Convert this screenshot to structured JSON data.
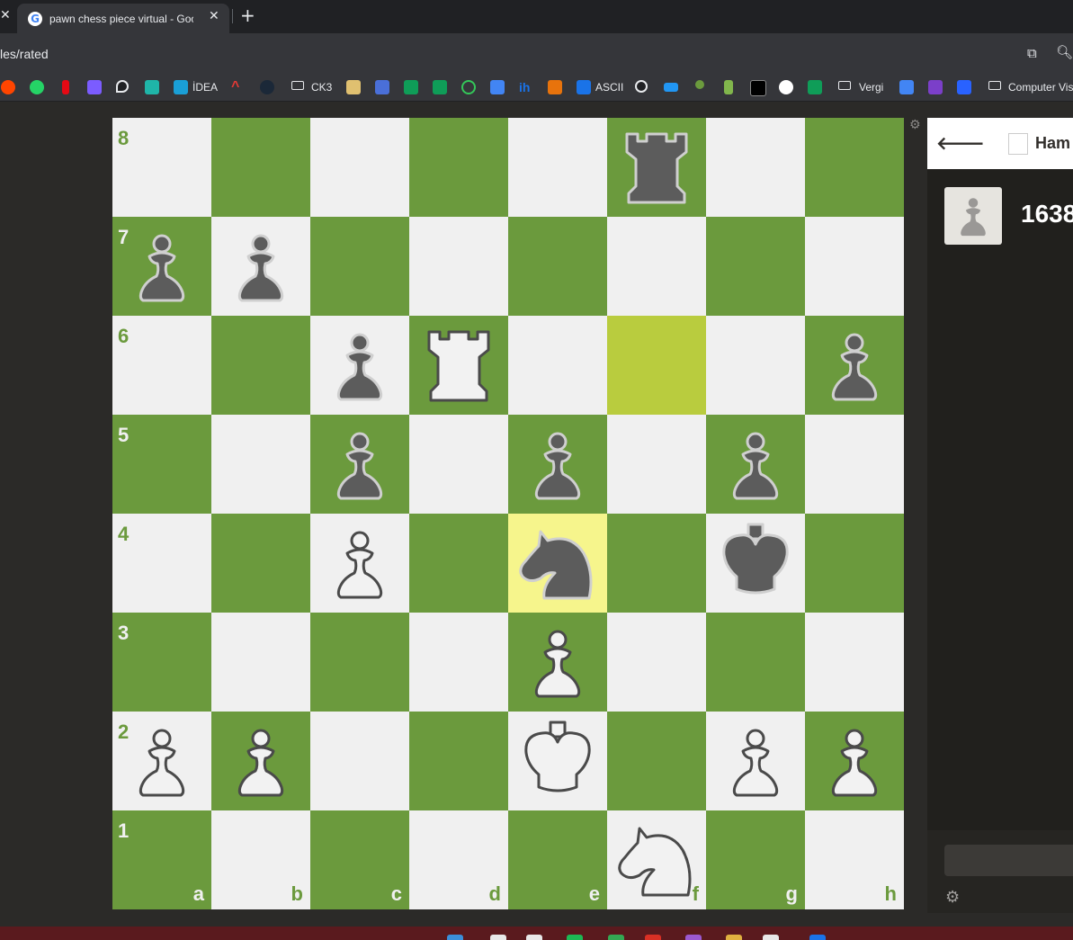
{
  "browser": {
    "tab_title": "pawn chess piece virtual - Goog",
    "tab_close": "✕",
    "new_tab": "+",
    "url": "les/rated",
    "bookmarks": [
      {
        "label": "İDEA"
      },
      {
        "label": "CK3"
      },
      {
        "label": "ASCII"
      },
      {
        "label": "Vergi"
      },
      {
        "label": "Computer Vis"
      }
    ]
  },
  "board": {
    "files": [
      "a",
      "b",
      "c",
      "d",
      "e",
      "f",
      "g",
      "h"
    ],
    "ranks": [
      "8",
      "7",
      "6",
      "5",
      "4",
      "3",
      "2",
      "1"
    ],
    "light_color": "#f0f0f0",
    "dark_color": "#6b9a3d",
    "highlight_from": "f6",
    "highlight_to": "e4",
    "highlight_from_color": "#b9cc3e",
    "highlight_to_color": "#f6f58c",
    "pieces": [
      {
        "square": "f8",
        "type": "rook",
        "color": "black"
      },
      {
        "square": "a7",
        "type": "pawn",
        "color": "black"
      },
      {
        "square": "b7",
        "type": "pawn",
        "color": "black"
      },
      {
        "square": "c6",
        "type": "pawn",
        "color": "black"
      },
      {
        "square": "d6",
        "type": "rook",
        "color": "white"
      },
      {
        "square": "h6",
        "type": "pawn",
        "color": "black"
      },
      {
        "square": "c5",
        "type": "pawn",
        "color": "black"
      },
      {
        "square": "e5",
        "type": "pawn",
        "color": "black"
      },
      {
        "square": "g5",
        "type": "pawn",
        "color": "black"
      },
      {
        "square": "c4",
        "type": "pawn",
        "color": "white"
      },
      {
        "square": "e4",
        "type": "knight",
        "color": "black"
      },
      {
        "square": "g4",
        "type": "king",
        "color": "black"
      },
      {
        "square": "e3",
        "type": "pawn",
        "color": "white"
      },
      {
        "square": "a2",
        "type": "pawn",
        "color": "white"
      },
      {
        "square": "b2",
        "type": "pawn",
        "color": "white"
      },
      {
        "square": "e2",
        "type": "king",
        "color": "white"
      },
      {
        "square": "g2",
        "type": "pawn",
        "color": "white"
      },
      {
        "square": "h2",
        "type": "pawn",
        "color": "white"
      },
      {
        "square": "f1",
        "type": "knight",
        "color": "white"
      }
    ]
  },
  "panel": {
    "back": "🡐",
    "player_name": "Ham",
    "rating": "1638",
    "gear": "⚙"
  }
}
